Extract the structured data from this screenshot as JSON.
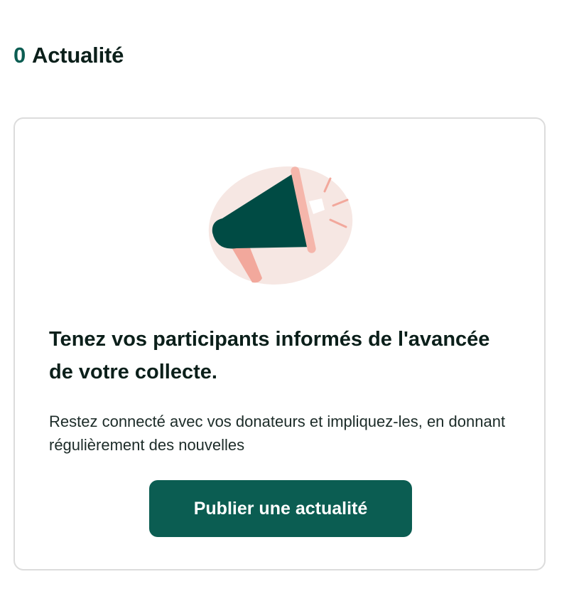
{
  "header": {
    "count": "0",
    "title": "Actualité"
  },
  "card": {
    "title": "Tenez vos participants informés de l'avancée de votre collecte.",
    "description": "Restez connecté avec vos donateurs et impliquez-les, en donnant régulièrement des nouvelles",
    "button_label": "Publier une actualité",
    "illustration_icon": "megaphone-icon"
  },
  "colors": {
    "brand": "#0b5d52",
    "text_dark": "#0b1f1a",
    "illustration_blob": "#f6e7e3",
    "illustration_pink": "#f2a89c",
    "border": "#dcdcdc"
  }
}
